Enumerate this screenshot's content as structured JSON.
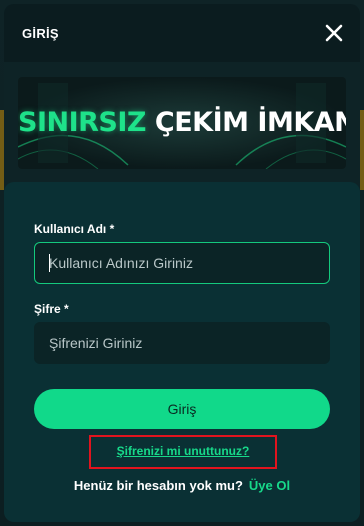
{
  "modal": {
    "title": "GİRİŞ",
    "close_icon": "close-icon"
  },
  "banner": {
    "word1": "SINIRSIZ",
    "word2": "ÇEKİM İMKANI"
  },
  "form": {
    "username_label": "Kullanıcı Adı *",
    "username_placeholder": "Kullanıcı Adınızı Giriniz",
    "username_value": "",
    "password_label": "Şifre *",
    "password_placeholder": "Şifrenizi Giriniz",
    "password_value": "",
    "submit_label": "Giriş",
    "forgot_password": "Şifrenizi mi unuttunuz?",
    "no_account_text": "Henüz bir hesabın yok mu?",
    "signup_link": "Üye Ol"
  },
  "colors": {
    "accent": "#11d98a",
    "highlight_box": "#e0141e",
    "card_bg": "#0a3034"
  }
}
